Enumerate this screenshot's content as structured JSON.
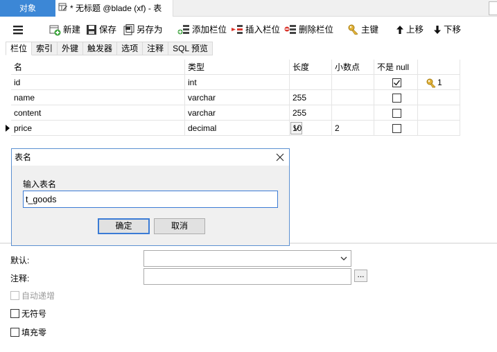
{
  "tabs": {
    "objects_label": "对象",
    "doc_label": "* 无标题 @blade (xf) - 表"
  },
  "toolbar": {
    "new_label": "新建",
    "save_label": "保存",
    "save_as_label": "另存为",
    "add_column_label": "添加栏位",
    "insert_column_label": "插入栏位",
    "delete_column_label": "删除栏位",
    "primary_key_label": "主键",
    "move_up_label": "上移",
    "move_down_label": "下移"
  },
  "subtabs": [
    "栏位",
    "索引",
    "外键",
    "触发器",
    "选项",
    "注释",
    "SQL 预览"
  ],
  "grid": {
    "headers": [
      "名",
      "类型",
      "长度",
      "小数点",
      "不是 null"
    ],
    "rows": [
      {
        "name": "id",
        "type": "int",
        "length": "",
        "decimals": "",
        "not_null": true,
        "key": "1"
      },
      {
        "name": "name",
        "type": "varchar",
        "length": "255",
        "decimals": "",
        "not_null": false,
        "key": ""
      },
      {
        "name": "content",
        "type": "varchar",
        "length": "255",
        "decimals": "",
        "not_null": false,
        "key": ""
      },
      {
        "name": "price",
        "type": "decimal",
        "length": "10",
        "decimals": "2",
        "not_null": false,
        "key": ""
      }
    ]
  },
  "dialog": {
    "title": "表名",
    "prompt": "输入表名",
    "value": "t_goods",
    "ok_label": "确定",
    "cancel_label": "取消"
  },
  "panel": {
    "default_label": "默认:",
    "comment_label": "注释:",
    "auto_increment_label": "自动递增",
    "unsigned_label": "无符号",
    "zerofill_label": "填充零",
    "ellipsis_label": "..."
  },
  "colors": {
    "accent": "#3c87d6",
    "key_icon": "#e2b33a"
  }
}
